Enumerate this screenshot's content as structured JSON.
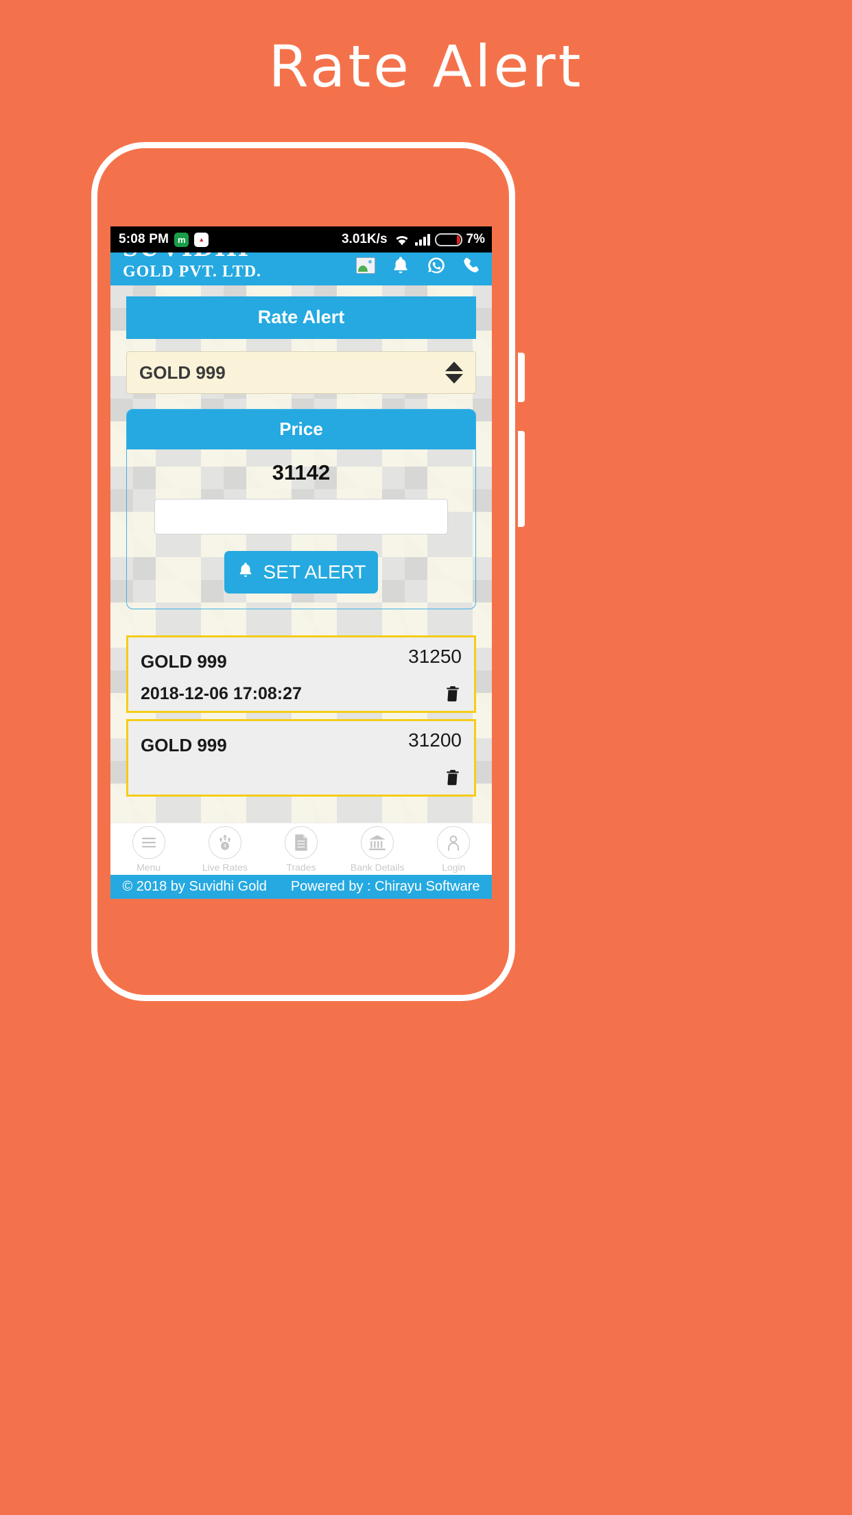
{
  "poster": {
    "title": "Rate Alert",
    "background_color": "#f4724b"
  },
  "status_bar": {
    "time": "5:08 PM",
    "app_icon_1": "m",
    "app_icon_2": "freecharge-icon",
    "network_speed": "3.01K/s",
    "wifi_icon": "wifi-icon",
    "signal_icon": "signal-bars-icon",
    "battery_icon": "battery-low-icon",
    "battery_percent": "7%"
  },
  "app_header": {
    "brand_line1": "SUVIDHI",
    "brand_line2": "GOLD PVT. LTD.",
    "image_icon": "image-placeholder-icon",
    "bell_icon": "bell-icon",
    "whatsapp_icon": "whatsapp-icon",
    "phone_icon": "phone-icon",
    "background_color": "#25a9e0"
  },
  "page": {
    "section_title": "Rate Alert",
    "product_select": {
      "value": "GOLD 999",
      "spinner_icon": "up-down-arrows-icon"
    },
    "price_panel": {
      "header": "Price",
      "value": "31142",
      "input_value": "",
      "input_placeholder": "",
      "set_alert_label": "SET ALERT",
      "set_alert_icon": "bell-icon"
    },
    "alerts": [
      {
        "product": "GOLD 999",
        "price": "31250",
        "datetime": "2018-12-06 17:08:27",
        "delete_icon": "trash-icon"
      },
      {
        "product": "GOLD 999",
        "price": "31200",
        "datetime": "",
        "delete_icon": "trash-icon"
      }
    ]
  },
  "bottom_nav": [
    {
      "label": "Menu",
      "icon": "hamburger-icon"
    },
    {
      "label": "Live Rates",
      "icon": "rupee-arrows-icon"
    },
    {
      "label": "Trades",
      "icon": "document-list-icon"
    },
    {
      "label": "Bank Details",
      "icon": "bank-icon"
    },
    {
      "label": "Login",
      "icon": "user-icon"
    }
  ],
  "footer": {
    "copyright": "© 2018 by Suvidhi Gold",
    "powered_by": "Powered by : Chirayu Software"
  },
  "colors": {
    "brand_blue": "#25a9e0",
    "poster_orange": "#f4724b",
    "alert_border_yellow": "#f5cc18",
    "select_cream": "#fbf3d9"
  }
}
